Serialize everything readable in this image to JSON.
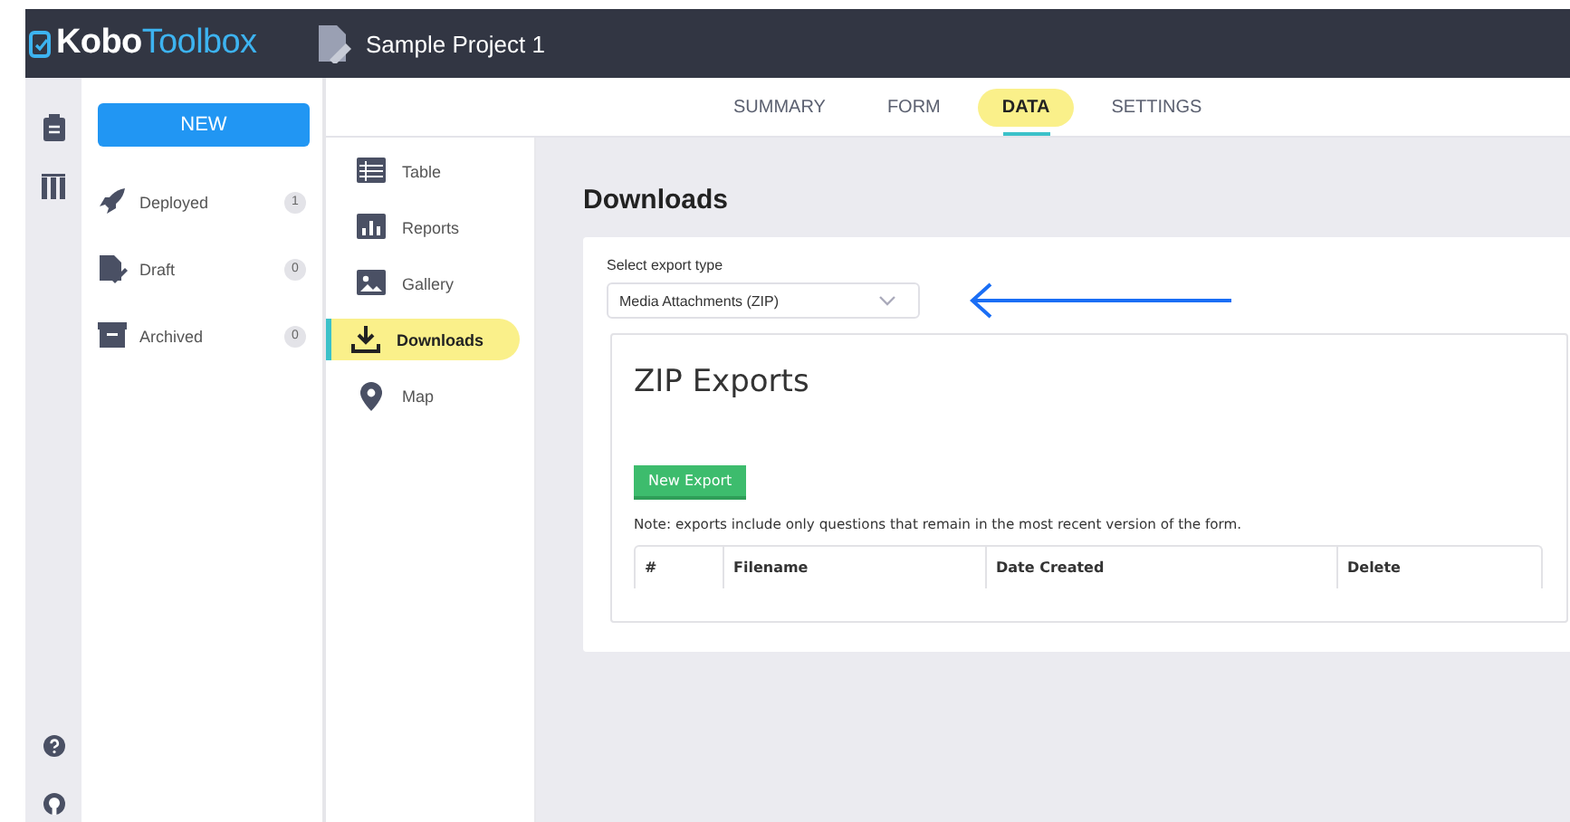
{
  "header": {
    "logo_bold": "Kobo",
    "logo_light": "Toolbox",
    "project_title": "Sample Project 1"
  },
  "tabs": [
    {
      "label": "SUMMARY",
      "selected": false
    },
    {
      "label": "FORM",
      "selected": false
    },
    {
      "label": "DATA",
      "selected": true
    },
    {
      "label": "SETTINGS",
      "selected": false
    }
  ],
  "sidebar": {
    "new_button": "NEW",
    "items": [
      {
        "kind": "deployed",
        "label": "Deployed",
        "count": "1"
      },
      {
        "kind": "draft",
        "label": "Draft",
        "count": "0"
      },
      {
        "kind": "archived",
        "label": "Archived",
        "count": "0"
      }
    ]
  },
  "data_nav": [
    {
      "kind": "table",
      "label": "Table",
      "selected": false
    },
    {
      "kind": "reports",
      "label": "Reports",
      "selected": false
    },
    {
      "kind": "gallery",
      "label": "Gallery",
      "selected": false
    },
    {
      "kind": "downloads",
      "label": "Downloads",
      "selected": true
    },
    {
      "kind": "map",
      "label": "Map",
      "selected": false
    }
  ],
  "downloads": {
    "title": "Downloads",
    "export_type_label": "Select export type",
    "export_type_value": "Media Attachments (ZIP)",
    "exports": {
      "title": "ZIP Exports",
      "new_export_button": "New Export",
      "note": "Note: exports include only questions that remain in the most recent version of the form.",
      "columns": [
        "#",
        "Filename",
        "Date Created",
        "Delete"
      ]
    }
  }
}
